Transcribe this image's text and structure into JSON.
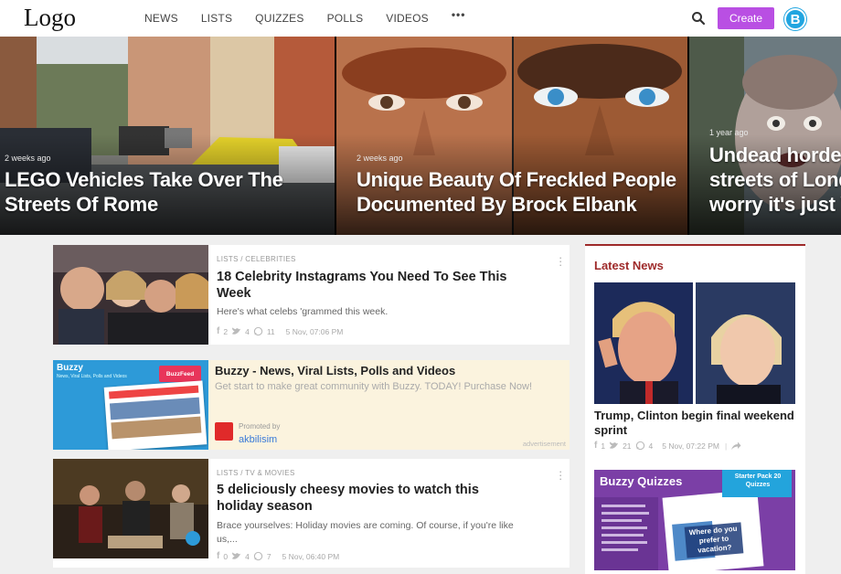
{
  "header": {
    "logo": "Logo",
    "nav": [
      "NEWS",
      "LISTS",
      "QUIZZES",
      "POLLS",
      "VIDEOS"
    ],
    "more": "•••",
    "create_label": "Create",
    "avatar_letter": "B"
  },
  "hero": [
    {
      "time": "2 weeks ago",
      "title_l1": "LEGO Vehicles Take Over The",
      "title_l2": "Streets Of Rome"
    },
    {
      "time": "2 weeks ago",
      "title_l1": "Unique Beauty Of Freckled People",
      "title_l2": "Documented By Brock Elbank"
    },
    {
      "time": "1 year ago",
      "title_l1": "Undead hordes",
      "title_l2": "streets of Lond",
      "title_l3": "worry it's just V"
    }
  ],
  "posts": [
    {
      "category": "LISTS / CELEBRITIES",
      "title": "18 Celebrity Instagrams You Need To See This Week",
      "description": "Here's what celebs 'grammed this week.",
      "shares_fb": "2",
      "shares_tw": "4",
      "comments": "11",
      "date": "5 Nov, 07:06 PM"
    },
    {
      "category": "LISTS / TV & MOVIES",
      "title": "5 deliciously cheesy movies to watch this holiday season",
      "description": "Brace yourselves: Holiday movies are coming. Of course, if you're like us,...",
      "shares_fb": "0",
      "shares_tw": "4",
      "comments": "7",
      "date": "5 Nov, 06:40 PM"
    }
  ],
  "ad": {
    "title": "Buzzy - News, Viral Lists, Polls and Videos",
    "text": "Get start to make great community with Buzzy. TODAY! Purchase Now!",
    "promoted_by": "Promoted by",
    "brand": "akbilisim",
    "label": "advertisement",
    "thumb_title": "Buzzy",
    "thumb_sub": "News, Viral Lists, Polls and Videos",
    "thumb_brand": "BuzzFeed"
  },
  "sidebar": {
    "heading": "Latest News",
    "news_title": "Trump, Clinton begin final weekend sprint",
    "shares_fb": "1",
    "shares_tw": "21",
    "comments": "4",
    "date": "5 Nov, 07:22 PM",
    "quiz_title": "Buzzy Quizzes",
    "quiz_badge": "Starter Pack 20 Quizzes",
    "quiz_card": "Where do you prefer to vacation?"
  },
  "colors": {
    "accent": "#b94fe3",
    "avatar": "#21a5e0",
    "sidebar_accent": "#9e2a2a",
    "ad_bg": "#fbf3de"
  }
}
